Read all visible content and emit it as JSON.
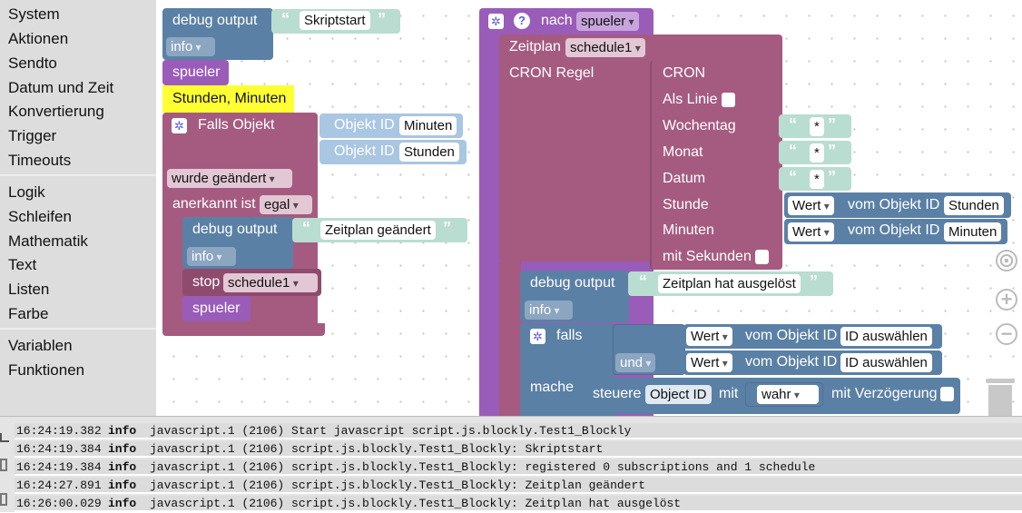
{
  "toolbox": {
    "categories": [
      "System",
      "Aktionen",
      "Sendto",
      "Datum und Zeit",
      "Konvertierung",
      "Trigger",
      "Timeouts",
      "Logik",
      "Schleifen",
      "Mathematik",
      "Text",
      "Listen",
      "Farbe",
      "Variablen",
      "Funktionen"
    ]
  },
  "left_script": {
    "debug_label": "debug output",
    "debug_text": "Skriptstart",
    "debug_level": "info",
    "var_spueler": "spueler",
    "comment": "Stunden, Minuten",
    "falls_objekt": "Falls Objekt",
    "objekt_id_label": "Objekt ID",
    "objekt_id_1": "Minuten",
    "objekt_id_2": "Stunden",
    "wurde_geaendert": "wurde geändert",
    "anerkannt_label": "anerkannt ist",
    "anerkannt_value": "egal",
    "inner_debug_label": "debug output",
    "inner_debug_text": "Zeitplan geändert",
    "inner_debug_level": "info",
    "stop_label": "stop",
    "stop_value": "schedule1",
    "inner_var": "spueler"
  },
  "right_script": {
    "nach_label": "nach",
    "nach_var": "spueler",
    "zeitplan_label": "Zeitplan",
    "zeitplan_value": "schedule1",
    "cron_regel": "CRON Regel",
    "cron": "CRON",
    "als_linie": "Als Linie",
    "wochentag": "Wochentag",
    "monat": "Monat",
    "datum": "Datum",
    "stunde": "Stunde",
    "minuten": "Minuten",
    "mit_sekunden": "mit Sekunden",
    "star": "*",
    "wert": "Wert",
    "vom_objekt_id": "vom Objekt ID",
    "obj_stunden": "Stunden",
    "obj_minuten": "Minuten",
    "debug_label": "debug output",
    "debug_text": "Zeitplan hat ausgelöst",
    "debug_level": "info",
    "falls": "falls",
    "und": "und",
    "id_auswaehlen": "ID auswählen",
    "mache": "mache",
    "steuere": "steuere",
    "object_id": "Object ID",
    "mit": "mit",
    "wahr": "wahr",
    "mit_verzoegerung": "mit Verzögerung"
  },
  "log": [
    {
      "time": "16:24:19.382",
      "severity": "info",
      "message": "javascript.1 (2106) Start javascript script.js.blockly.Test1_Blockly"
    },
    {
      "time": "16:24:19.384",
      "severity": "info",
      "message": "javascript.1 (2106) script.js.blockly.Test1_Blockly: Skriptstart"
    },
    {
      "time": "16:24:19.384",
      "severity": "info",
      "message": "javascript.1 (2106) script.js.blockly.Test1_Blockly: registered 0 subscriptions and 1 schedule"
    },
    {
      "time": "16:24:27.891",
      "severity": "info",
      "message": "javascript.1 (2106) script.js.blockly.Test1_Blockly: Zeitplan geändert"
    },
    {
      "time": "16:26:00.029",
      "severity": "info",
      "message": "javascript.1 (2106) script.js.blockly.Test1_Blockly: Zeitplan hat ausgelöst"
    }
  ],
  "workspace_controls": [
    "target-icon",
    "zoom-in-icon",
    "zoom-out-icon",
    "trash-icon"
  ],
  "colors": {
    "logic_blue": "#5b80a5",
    "purple": "#9a5cb9",
    "trigger_mauve": "#a55b80",
    "string_green": "#b9ddd0",
    "comment_yellow": "#ffff33"
  }
}
